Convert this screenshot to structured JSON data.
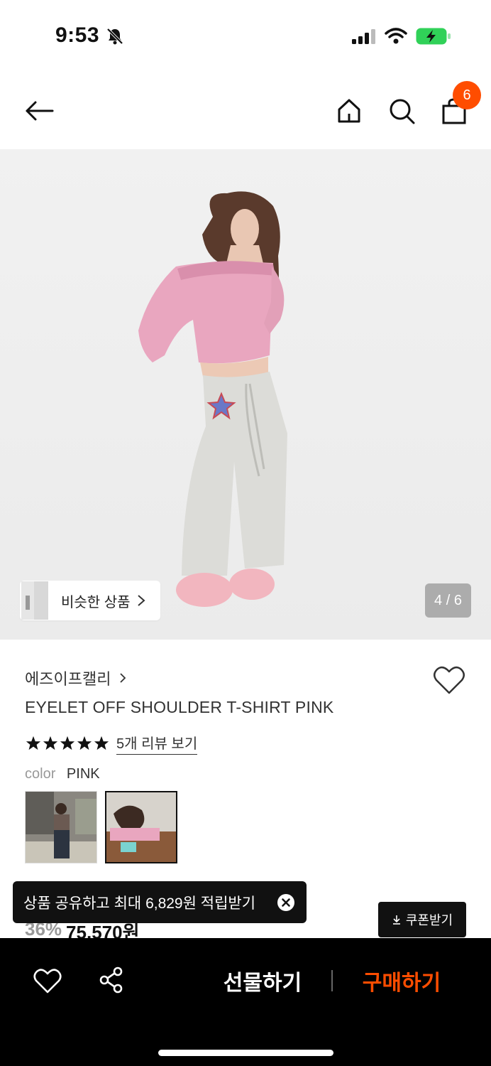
{
  "status_bar": {
    "time": "9:53"
  },
  "header": {
    "cart_count": "6"
  },
  "gallery": {
    "similar_label": "비슷한 상품",
    "counter": "4 / 6"
  },
  "product": {
    "brand": "에즈이프캘리",
    "title": "EYELET OFF SHOULDER T-SHIRT PINK",
    "rating_stars": 5,
    "review_link": "5개 리뷰 보기",
    "color_key": "color",
    "color_value": "PINK",
    "discount": "36%",
    "price": "75,570원"
  },
  "toast": {
    "text": "상품 공유하고 최대 6,829원 적립받기"
  },
  "coupon": {
    "label": "쿠폰받기"
  },
  "bottom_bar": {
    "gift_label": "선물하기",
    "buy_label": "구매하기"
  },
  "colors": {
    "accent": "#ff4d00",
    "shirt_pink": "#e9a6bf",
    "pants_grey": "#dcdcd8"
  },
  "icons": [
    "bell-slash-icon",
    "signal-icon",
    "wifi-icon",
    "battery-charging-icon",
    "back-arrow-icon",
    "home-icon",
    "search-icon",
    "bag-icon",
    "chevron-right-icon",
    "heart-icon",
    "star-icon",
    "close-icon",
    "download-icon",
    "share-icon"
  ]
}
